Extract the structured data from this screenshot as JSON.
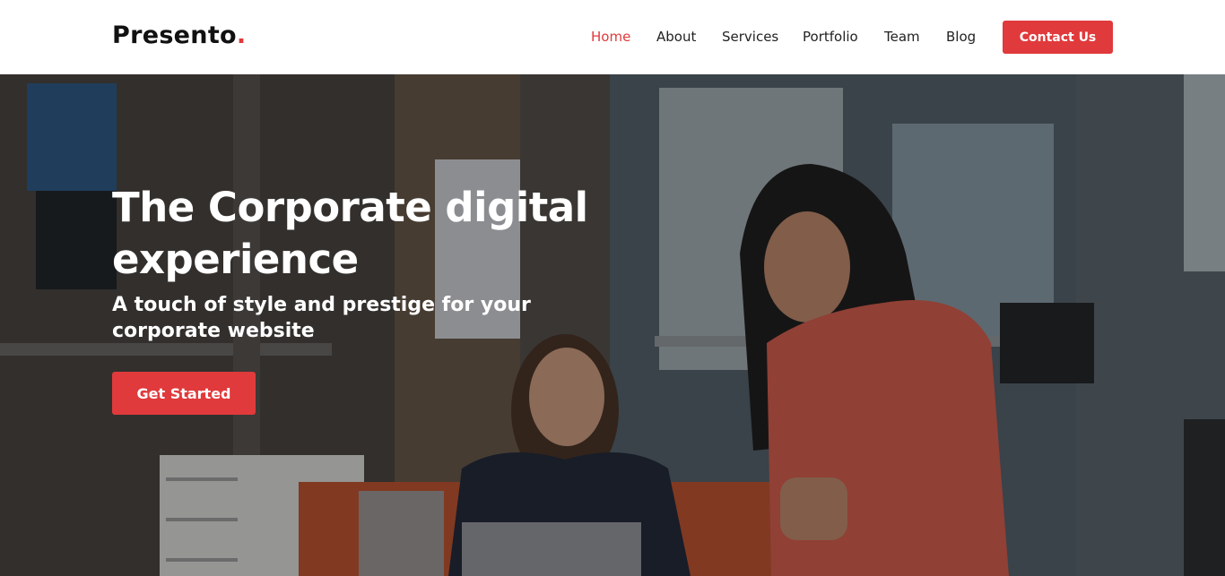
{
  "header": {
    "logo_text": "Presento",
    "logo_dot": ".",
    "nav": [
      "Home",
      "About",
      "Services",
      "Portfolio",
      "Team",
      "Blog"
    ],
    "active_nav": "Home",
    "contact_label": "Contact Us"
  },
  "hero": {
    "title": "The Corporate digital experience",
    "subtitle": "A touch of style and prestige for your corporate website",
    "cta_label": "Get Started",
    "background_image": "office photo: two women looking at a laptop"
  },
  "colors": {
    "accent": "#e03a3c",
    "nav_text": "#222222",
    "hero_text": "#ffffff"
  }
}
